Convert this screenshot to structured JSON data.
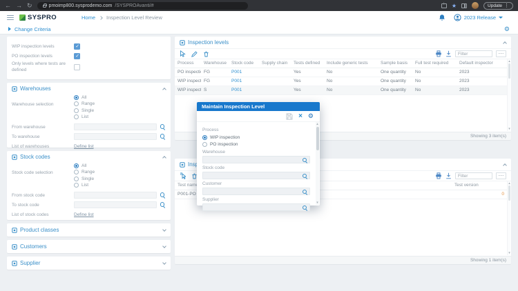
{
  "colors": {
    "brand_blue": "#1878cc",
    "link_blue": "#2e8fd0",
    "panel_title_blue": "#3a8fc8",
    "checkbox_blue": "#5b9bd5",
    "logo_green": "#57b847",
    "warning_orange": "#e2903f",
    "page_background": "#edf0f3"
  },
  "browser": {
    "url_host": "pmoimp800.sysprodemo.com",
    "url_path": "/SYSPROAvanti/#",
    "update_label": "Update"
  },
  "header": {
    "logo_text": "SYSPRO",
    "breadcrumb_home": "Home",
    "breadcrumb_current": "Inspection Level Review",
    "release_label": "2023 Release"
  },
  "criteria": {
    "label": "Change Criteria"
  },
  "filters": {
    "checkboxes": [
      {
        "label": "WIP inspection levels",
        "checked": true
      },
      {
        "label": "PO inspection levels",
        "checked": true
      },
      {
        "label": "Only levels where tests are defined",
        "checked": false
      }
    ],
    "warehouses": {
      "title": "Warehouses",
      "selection_label": "Warehouse selection",
      "options": [
        {
          "label": "All",
          "selected": true
        },
        {
          "label": "Range"
        },
        {
          "label": "Single"
        },
        {
          "label": "List"
        }
      ],
      "from_label": "From warehouse",
      "to_label": "To warehouse",
      "list_label": "List of warehouses",
      "define_link": "Define list"
    },
    "stock_codes": {
      "title": "Stock codes",
      "selection_label": "Stock code selection",
      "options": [
        {
          "label": "All",
          "selected": true
        },
        {
          "label": "Range"
        },
        {
          "label": "Single"
        },
        {
          "label": "List"
        }
      ],
      "from_label": "From stock code",
      "to_label": "To stock code",
      "list_label": "List of stock codes",
      "define_link": "Define list"
    },
    "collapsed": [
      "Product classes",
      "Customers",
      "Supplier"
    ]
  },
  "levels_grid": {
    "title": "Inspection levels",
    "filter_placeholder": "Filter",
    "columns": [
      "Process",
      "Warehouse",
      "Stock code",
      "Supply chain",
      "Tests defined",
      "Include generic tests",
      "Sample basis",
      "Full test required",
      "Default inspector"
    ],
    "rows": [
      [
        "PO inspection",
        "FG",
        "P001",
        "",
        "Yes",
        "No",
        "One quantity",
        "No",
        "2023"
      ],
      [
        "WIP inspection",
        "FG",
        "P001",
        "",
        "Yes",
        "No",
        "One quantity",
        "No",
        "2023"
      ],
      [
        "WIP inspection",
        "S",
        "P001",
        "",
        "Yes",
        "No",
        "One quantity",
        "No",
        "2023"
      ]
    ],
    "footer": "Showing 3 item(s)"
  },
  "tests_grid": {
    "title": "Inspection tests",
    "filter_placeholder": "Filter",
    "columns": [
      "Test name",
      "Test version"
    ],
    "rows": [
      [
        "P001-PO",
        "0"
      ]
    ],
    "footer": "Showing 1 item(s)"
  },
  "modal": {
    "title": "Maintain Inspection Level",
    "process_label": "Process",
    "options": [
      {
        "label": "WIP inspection",
        "selected": true
      },
      {
        "label": "PO inspection"
      }
    ],
    "warehouse_label": "Warehouse",
    "stock_code_label": "Stock code",
    "customer_label": "Customer",
    "supplier_label": "Supplier"
  }
}
